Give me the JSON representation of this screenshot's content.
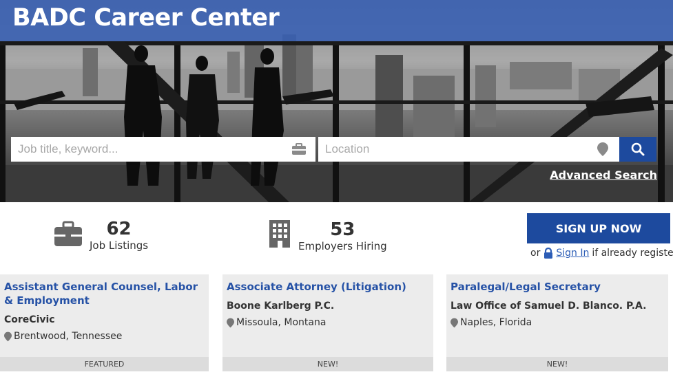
{
  "header": {
    "title": "BADC Career Center"
  },
  "search": {
    "keyword_placeholder": "Job title, keyword...",
    "location_placeholder": "Location",
    "advanced_label": "Advanced Search"
  },
  "stats": [
    {
      "value": "62",
      "label": "Job Listings",
      "icon": "briefcase-icon"
    },
    {
      "value": "53",
      "label": "Employers Hiring",
      "icon": "building-icon"
    }
  ],
  "signup": {
    "button_label": "SIGN UP NOW",
    "prefix": "or",
    "signin_label": "Sign In",
    "suffix": "if already registered"
  },
  "jobs": [
    {
      "title": "Assistant General Counsel, Labor & Employment",
      "company": "CoreCivic",
      "location": "Brentwood, Tennessee",
      "tag": "FEATURED"
    },
    {
      "title": "Associate Attorney (Litigation)",
      "company": "Boone Karlberg P.C.",
      "location": "Missoula, Montana",
      "tag": "NEW!"
    },
    {
      "title": "Paralegal/Legal Secretary",
      "company": "Law Office of Samuel D. Blanco. P.A.",
      "location": "Naples, Florida",
      "tag": "NEW!"
    }
  ],
  "colors": {
    "brand_blue": "#1d4a9e",
    "link_blue": "#2652a6",
    "title_band": "#3860b4",
    "card_bg": "#ececec"
  }
}
